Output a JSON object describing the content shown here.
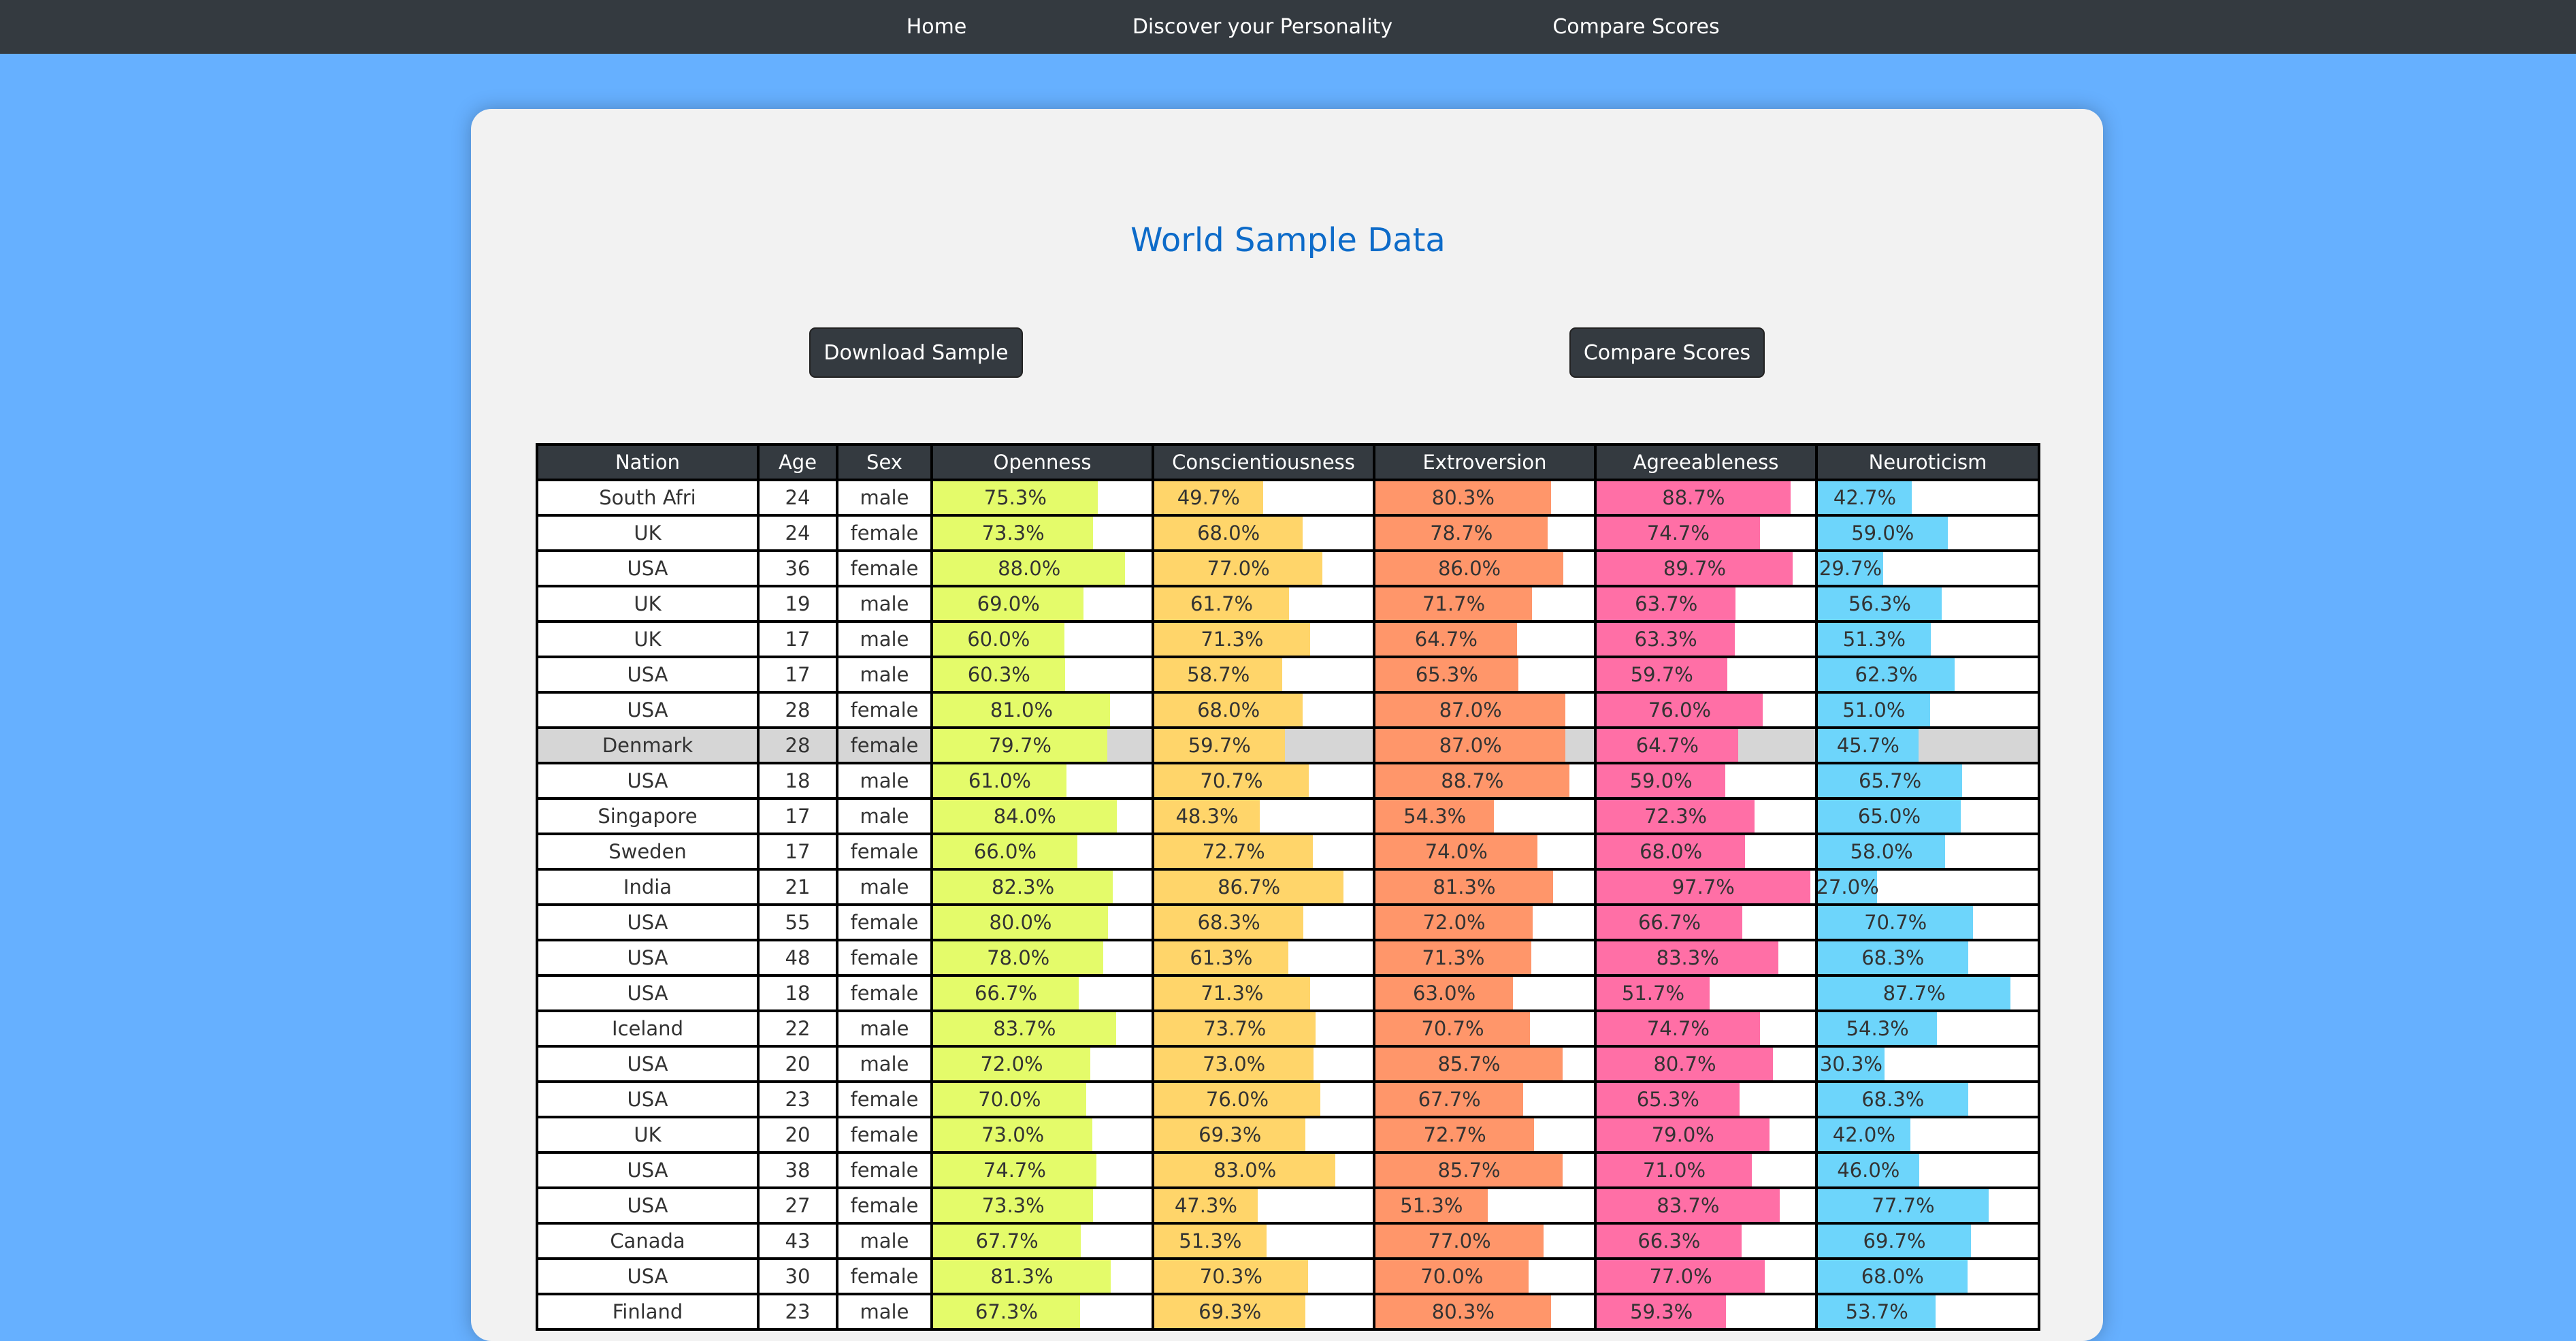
{
  "nav": {
    "home": "Home",
    "discover": "Discover your Personality",
    "compare": "Compare Scores"
  },
  "page_title": "World Sample Data",
  "buttons": {
    "download": "Download Sample",
    "compare": "Compare Scores"
  },
  "colors": {
    "openness": "#e4fb6a",
    "conscientiousness": "#ffd56a",
    "extroversion": "#ff966a",
    "agreeableness": "#ff6fa6",
    "neuroticism": "#6dd5fb",
    "background": "#66b0ff",
    "navbar": "#343a40",
    "title": "#0d6bc9"
  },
  "table": {
    "headers": [
      "Nation",
      "Age",
      "Sex",
      "Openness",
      "Conscientiousness",
      "Extroversion",
      "Agreeableness",
      "Neuroticism"
    ],
    "trait_keys": [
      "openness",
      "conscientiousness",
      "extroversion",
      "agreeableness",
      "neuroticism"
    ],
    "highlight_row": 7,
    "rows": [
      {
        "nation": "South Afri",
        "age": "24",
        "sex": "male",
        "traits": [
          "75.3%",
          "49.7%",
          "80.3%",
          "88.7%",
          "42.7%"
        ]
      },
      {
        "nation": "UK",
        "age": "24",
        "sex": "female",
        "traits": [
          "73.3%",
          "68.0%",
          "78.7%",
          "74.7%",
          "59.0%"
        ]
      },
      {
        "nation": "USA",
        "age": "36",
        "sex": "female",
        "traits": [
          "88.0%",
          "77.0%",
          "86.0%",
          "89.7%",
          "29.7%"
        ]
      },
      {
        "nation": "UK",
        "age": "19",
        "sex": "male",
        "traits": [
          "69.0%",
          "61.7%",
          "71.7%",
          "63.7%",
          "56.3%"
        ]
      },
      {
        "nation": "UK",
        "age": "17",
        "sex": "male",
        "traits": [
          "60.0%",
          "71.3%",
          "64.7%",
          "63.3%",
          "51.3%"
        ]
      },
      {
        "nation": "USA",
        "age": "17",
        "sex": "male",
        "traits": [
          "60.3%",
          "58.7%",
          "65.3%",
          "59.7%",
          "62.3%"
        ]
      },
      {
        "nation": "USA",
        "age": "28",
        "sex": "female",
        "traits": [
          "81.0%",
          "68.0%",
          "87.0%",
          "76.0%",
          "51.0%"
        ]
      },
      {
        "nation": "Denmark",
        "age": "28",
        "sex": "female",
        "traits": [
          "79.7%",
          "59.7%",
          "87.0%",
          "64.7%",
          "45.7%"
        ]
      },
      {
        "nation": "USA",
        "age": "18",
        "sex": "male",
        "traits": [
          "61.0%",
          "70.7%",
          "88.7%",
          "59.0%",
          "65.7%"
        ]
      },
      {
        "nation": "Singapore",
        "age": "17",
        "sex": "male",
        "traits": [
          "84.0%",
          "48.3%",
          "54.3%",
          "72.3%",
          "65.0%"
        ]
      },
      {
        "nation": "Sweden",
        "age": "17",
        "sex": "female",
        "traits": [
          "66.0%",
          "72.7%",
          "74.0%",
          "68.0%",
          "58.0%"
        ]
      },
      {
        "nation": "India",
        "age": "21",
        "sex": "male",
        "traits": [
          "82.3%",
          "86.7%",
          "81.3%",
          "97.7%",
          "27.0%"
        ]
      },
      {
        "nation": "USA",
        "age": "55",
        "sex": "female",
        "traits": [
          "80.0%",
          "68.3%",
          "72.0%",
          "66.7%",
          "70.7%"
        ]
      },
      {
        "nation": "USA",
        "age": "48",
        "sex": "female",
        "traits": [
          "78.0%",
          "61.3%",
          "71.3%",
          "83.3%",
          "68.3%"
        ]
      },
      {
        "nation": "USA",
        "age": "18",
        "sex": "female",
        "traits": [
          "66.7%",
          "71.3%",
          "63.0%",
          "51.7%",
          "87.7%"
        ]
      },
      {
        "nation": "Iceland",
        "age": "22",
        "sex": "male",
        "traits": [
          "83.7%",
          "73.7%",
          "70.7%",
          "74.7%",
          "54.3%"
        ]
      },
      {
        "nation": "USA",
        "age": "20",
        "sex": "male",
        "traits": [
          "72.0%",
          "73.0%",
          "85.7%",
          "80.7%",
          "30.3%"
        ]
      },
      {
        "nation": "USA",
        "age": "23",
        "sex": "female",
        "traits": [
          "70.0%",
          "76.0%",
          "67.7%",
          "65.3%",
          "68.3%"
        ]
      },
      {
        "nation": "UK",
        "age": "20",
        "sex": "female",
        "traits": [
          "73.0%",
          "69.3%",
          "72.7%",
          "79.0%",
          "42.0%"
        ]
      },
      {
        "nation": "USA",
        "age": "38",
        "sex": "female",
        "traits": [
          "74.7%",
          "83.0%",
          "85.7%",
          "71.0%",
          "46.0%"
        ]
      },
      {
        "nation": "USA",
        "age": "27",
        "sex": "female",
        "traits": [
          "73.3%",
          "47.3%",
          "51.3%",
          "83.7%",
          "77.7%"
        ]
      },
      {
        "nation": "Canada",
        "age": "43",
        "sex": "male",
        "traits": [
          "67.7%",
          "51.3%",
          "77.0%",
          "66.3%",
          "69.7%"
        ]
      },
      {
        "nation": "USA",
        "age": "30",
        "sex": "female",
        "traits": [
          "81.3%",
          "70.3%",
          "70.0%",
          "77.0%",
          "68.0%"
        ]
      },
      {
        "nation": "Finland",
        "age": "23",
        "sex": "male",
        "traits": [
          "67.3%",
          "69.3%",
          "80.3%",
          "59.3%",
          "53.7%"
        ]
      }
    ]
  }
}
